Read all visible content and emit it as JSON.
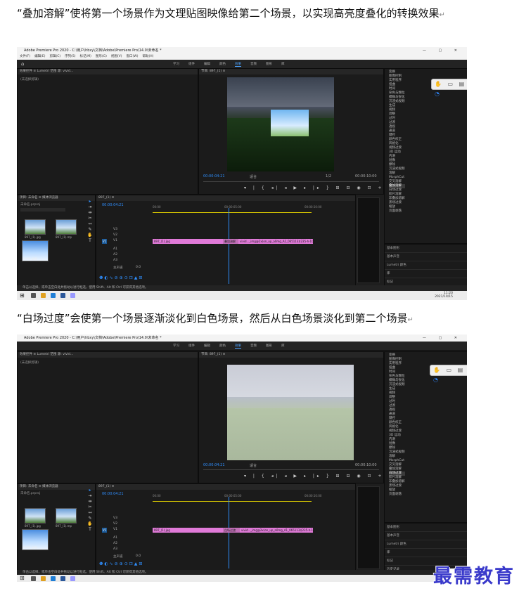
{
  "captions": {
    "first": "“叠加溶解”使将第一个场景作为文理贴图映像给第二个场景，以实现高亮度叠化的转换效果",
    "second": "“白场过度”会使第一个场景逐渐淡化到白色场景，然后从白色场景淡化到第二个场景",
    "return_mark": "↵"
  },
  "app": {
    "title": "Adobe Premiere Pro 2020 - C:\\用户\\hbxy\\文档\\Adobe\\Premiere Pro\\14.0\\未命名 *",
    "window_controls": "— ▢ ✕",
    "menus": [
      "文件(F)",
      "编辑(E)",
      "剪辑(C)",
      "序列(S)",
      "标记(M)",
      "图形(G)",
      "视图(V)",
      "窗口(W)",
      "帮助(H)"
    ],
    "workspaces": [
      "学习",
      "组件",
      "编辑",
      "颜色",
      "效果",
      "音频",
      "图形",
      "库"
    ],
    "active_workspace": "效果",
    "source_panel_tabs": "效果控件 ≡   Lumetri 范围   源: vivid...",
    "no_clip": "(未选择剪辑)",
    "program_title": "节目: 897_(1) ≡",
    "program_timecode": "00:00:04:21",
    "fit_label": "适合",
    "page_fraction": "1/2",
    "program_duration": "00:00:10:00",
    "project_panel_tabs": "项目: 未命名 ≡   媒体浏览器",
    "project_file": "未命名.prproj",
    "thumbnails": [
      "897_(1).jpg",
      "897_(1).mp",
      "vivid...jpg"
    ],
    "sequence_tab": "897_(1) ≡",
    "timeline_timecode": "00:00:04:21",
    "ruler_left": "00:00",
    "ruler_mid": "00:00:05:00",
    "ruler_right": "00:00:10:00",
    "tracks": [
      "V3",
      "V2",
      "V1",
      "A1",
      "A2",
      "A3"
    ],
    "master": "主声道",
    "master_value": "0.0",
    "clip_a": "897_(1).jpg",
    "clip_b": "vivid..._img@2x(on_up_a0mg_A1_065113)(235-h-1000)jpg",
    "transition_dissolve": "叠加溶解",
    "transition_white": "白场过渡",
    "statusbar": "单击以选择，或单击空白处并拖动以进行框选，使用 Shift、Alt 和 Ctrl 可获得其他选项。",
    "clock": [
      "11:20",
      "2021/10/15"
    ],
    "effects_tree": [
      "预设",
      "Lumetri 预设",
      "音频效果",
      "音频过渡",
      "视频效果",
      "视频过渡",
      "3D 运动",
      "内滑",
      "划像",
      "擦除",
      "沉浸式视频",
      "溶解",
      "MorphCut",
      "交叉溶解",
      "叠加溶解",
      "白场过渡",
      "胶片溶解",
      "非叠加溶解",
      "黑场过渡",
      "缩放",
      "页面剥落"
    ],
    "effects_tree_left": [
      "变换",
      "图像控制",
      "实用程序",
      "扭曲",
      "时间",
      "杂色与颗粒",
      "模糊与锐化",
      "沉浸式视频",
      "生成",
      "视频",
      "调整",
      "过时",
      "过渡",
      "透视",
      "通道",
      "键控",
      "颜色校正",
      "风格化"
    ],
    "props": [
      "基本图形",
      "基本声音",
      "Lumetri 颜色",
      "库",
      "标记",
      "历史记录",
      "信息"
    ]
  },
  "colors": {
    "accent": "#2f8fff",
    "clip": "#e07ad8",
    "watermark": "#3a3acb"
  },
  "watermark_text": "最需教育"
}
